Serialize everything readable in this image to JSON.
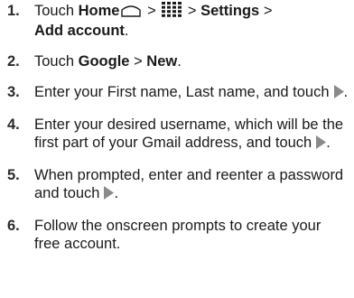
{
  "steps": [
    {
      "number": "1.",
      "touch": "Touch",
      "home": "Home",
      "gt1": ">",
      "gt2": ">",
      "settings": "Settings",
      "gt3": ">",
      "add_account": "Add account",
      "period": "."
    },
    {
      "number": "2.",
      "touch": "Touch",
      "google": "Google",
      "gt": ">",
      "new": "New",
      "period": "."
    },
    {
      "number": "3.",
      "text": "Enter your First name, Last name, and touch",
      "period": "."
    },
    {
      "number": "4.",
      "text": "Enter your desired username, which will be the first part of your Gmail address, and touch",
      "period": "."
    },
    {
      "number": "5.",
      "text": "When prompted, enter and reenter a password and touch",
      "period": "."
    },
    {
      "number": "6.",
      "text": "Follow the onscreen prompts to create your free account."
    }
  ],
  "icons": {
    "home": "home-icon",
    "apps": "apps-grid-icon",
    "next": "next-arrow-icon"
  },
  "colors": {
    "text": "#1a1a1a",
    "icon_grey": "#8a8a8a"
  }
}
